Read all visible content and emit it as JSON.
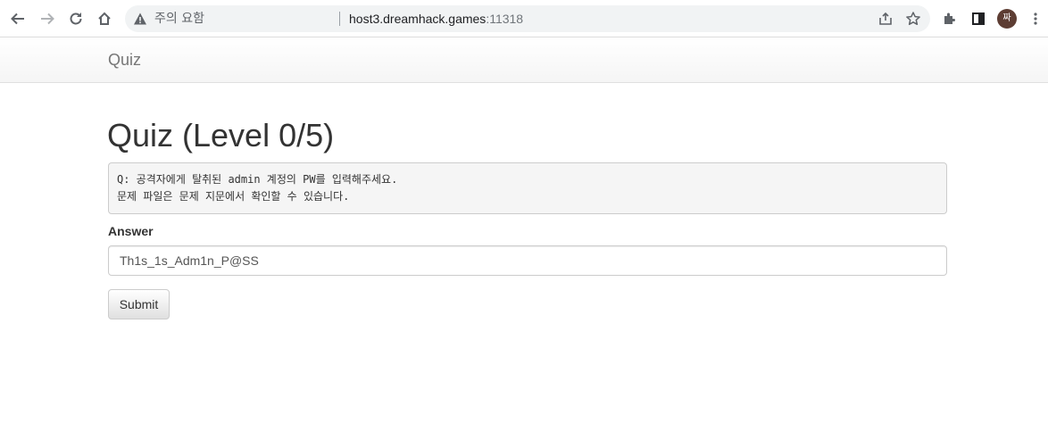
{
  "browser": {
    "security_label": "주의 요함",
    "url_host": "host3.dreamhack.games",
    "url_port": ":11318",
    "avatar_label": "짜",
    "icons": [
      "back-icon",
      "forward-icon",
      "reload-icon",
      "home-icon",
      "warning-icon",
      "share-icon",
      "star-icon",
      "extensions-icon",
      "side-panel-icon",
      "menu-icon"
    ]
  },
  "navbar": {
    "brand": "Quiz"
  },
  "main": {
    "title": "Quiz (Level 0/5)",
    "question": "Q: 공격자에게 탈취된 admin 계정의 PW를 입력해주세요.\n문제 파일은 문제 지문에서 확인할 수 있습니다.",
    "answer_label": "Answer",
    "answer_value": "Th1s_1s_Adm1n_P@SS",
    "submit_label": "Submit"
  }
}
